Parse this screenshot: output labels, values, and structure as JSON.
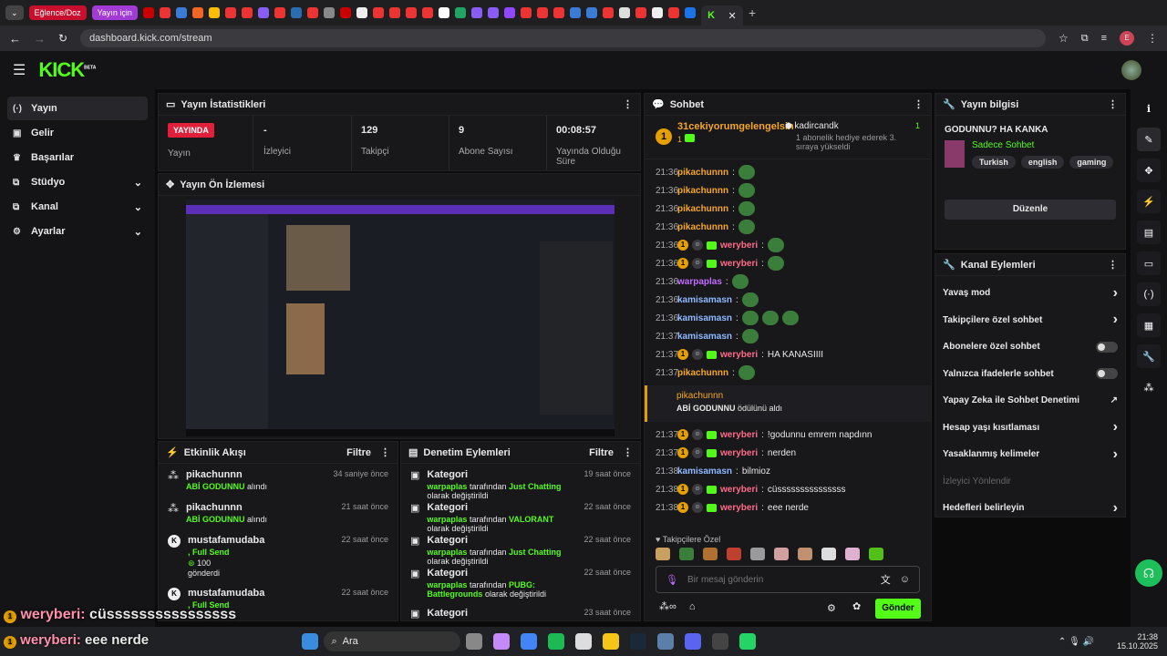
{
  "tabs": {
    "pill1": "Eğlence/Doz",
    "pill2": "Yayın için"
  },
  "address": {
    "url": "dashboard.kick.com/stream"
  },
  "brand": {
    "logo": "KICK",
    "beta": "BETA",
    "accent": "#53fc18"
  },
  "sidebar": {
    "items": [
      {
        "label": "Yayın",
        "icon": "(·)"
      },
      {
        "label": "Gelir",
        "icon": "▣"
      },
      {
        "label": "Başarılar",
        "icon": "♛"
      },
      {
        "label": "Stüdyo",
        "icon": "⧉"
      },
      {
        "label": "Kanal",
        "icon": "⧉"
      },
      {
        "label": "Ayarlar",
        "icon": "⚙"
      }
    ]
  },
  "stats": {
    "title": "Yayın İstatistikleri",
    "live_badge": "YAYINDA",
    "live_label": "Yayın",
    "viewers_value": "-",
    "viewers_label": "İzleyici",
    "followers_value": "129",
    "followers_label": "Takipçi",
    "subs_value": "9",
    "subs_label": "Abone Sayısı",
    "uptime_value": "00:08:57",
    "uptime_label": "Yayında Olduğu Süre"
  },
  "preview": {
    "title": "Yayın Ön İzlemesi"
  },
  "activity": {
    "title": "Etkinlik Akışı",
    "filter": "Filtre",
    "items": [
      {
        "user": "pikachunnn",
        "time": "34 saniye önce",
        "line1": "ABİ GODUNNU",
        "line1b": "alındı"
      },
      {
        "user": "pikachunnn",
        "time": "21 saat önce",
        "line1": "ABİ GODUNNU",
        "line1b": "alındı"
      },
      {
        "user": "mustafamudaba",
        "time": "22 saat önce",
        "line1": ", Full Send",
        "amount": "100",
        "line2": "gönderdi"
      },
      {
        "user": "mustafamudaba",
        "time": "22 saat önce",
        "line1": ", Full Send"
      }
    ]
  },
  "moderation": {
    "title": "Denetim Eylemleri",
    "filter": "Filtre",
    "items": [
      {
        "title": "Kategori",
        "time": "19 saat önce",
        "user": "warpaplas",
        "mid": "tarafından",
        "cat": "Just Chatting",
        "end": "olarak değiştirildi"
      },
      {
        "title": "Kategori",
        "time": "22 saat önce",
        "user": "warpaplas",
        "mid": "tarafından",
        "cat": "VALORANT",
        "end": "olarak değiştirildi"
      },
      {
        "title": "Kategori",
        "time": "22 saat önce",
        "user": "warpaplas",
        "mid": "tarafından",
        "cat": "Just Chatting",
        "end": "olarak değiştirildi"
      },
      {
        "title": "Kategori",
        "time": "22 saat önce",
        "user": "warpaplas",
        "mid": "tarafından",
        "cat": "PUBG: Battlegrounds",
        "end": "olarak değiştirildi"
      },
      {
        "title": "Kategori",
        "time": "23 saat önce"
      }
    ]
  },
  "chat": {
    "title": "Sohbet",
    "pinned_user": "31cekiyorumgelengelsin",
    "pinned_count": "1",
    "gifter": "kadircandk",
    "gifter_count": "1",
    "gifter_text": "1 abonelik hediye ederek 3. sıraya yükseldi",
    "messages": [
      {
        "t": "21:36",
        "u": "pikachunnn",
        "c": "#f5a623",
        "e": 1
      },
      {
        "t": "21:36",
        "u": "pikachunnn",
        "c": "#f5a623",
        "e": 1
      },
      {
        "t": "21:36",
        "u": "pikachunnn",
        "c": "#f5a623",
        "e": 1
      },
      {
        "t": "21:36",
        "u": "pikachunnn",
        "c": "#f5a623",
        "e": 1
      },
      {
        "t": "21:36",
        "u": "weryberi",
        "c": "#ff6b8a",
        "b": 1,
        "e": 1
      },
      {
        "t": "21:36",
        "u": "weryberi",
        "c": "#ff6b8a",
        "b": 1,
        "e": 1
      },
      {
        "t": "21:36",
        "u": "warpaplas",
        "c": "#c26bff",
        "e": 1
      },
      {
        "t": "21:36",
        "u": "kamisamasn",
        "c": "#8fb8ff",
        "e": 1
      },
      {
        "t": "21:36",
        "u": "kamisamasn",
        "c": "#8fb8ff",
        "e": 3
      },
      {
        "t": "21:37",
        "u": "kamisamasn",
        "c": "#8fb8ff",
        "e": 1
      },
      {
        "t": "21:37",
        "u": "weryberi",
        "c": "#ff6b8a",
        "b": 1,
        "m": "HA KANASIIII"
      },
      {
        "t": "21:37",
        "u": "pikachunnn",
        "c": "#f5a623",
        "e": 1
      }
    ],
    "reward_user": "pikachunnn",
    "reward_title": "ABİ GODUNNU",
    "reward_text": "ödülünü aldı",
    "messages2": [
      {
        "t": "21:37",
        "u": "weryberi",
        "c": "#ff6b8a",
        "b": 1,
        "m": "!godunnu emrem napdınn"
      },
      {
        "t": "21:37",
        "u": "weryberi",
        "c": "#ff6b8a",
        "b": 1,
        "m": "nerden"
      },
      {
        "t": "21:38",
        "u": "kamisamasn",
        "c": "#8fb8ff",
        "m": "bilmioz"
      },
      {
        "t": "21:38",
        "u": "weryberi",
        "c": "#ff6b8a",
        "b": 1,
        "m": "cüsssssssssssssss"
      },
      {
        "t": "21:38",
        "u": "weryberi",
        "c": "#ff6b8a",
        "b": 1,
        "m": "eee nerde"
      }
    ],
    "emote_section": "Takipçilere Özel",
    "placeholder": "Bir mesaj gönderin",
    "send": "Gönder"
  },
  "info": {
    "title": "Yayın bilgisi",
    "stream_title": "GODUNNU? HA KANKA",
    "category": "Sadece Sohbet",
    "tags": [
      "Turkish",
      "english",
      "gaming"
    ],
    "edit": "Düzenle"
  },
  "actions": {
    "title": "Kanal Eylemleri",
    "items": [
      {
        "label": "Yavaş mod",
        "kind": "arrow"
      },
      {
        "label": "Takipçilere özel sohbet",
        "kind": "arrow"
      },
      {
        "label": "Abonelere özel sohbet",
        "kind": "toggle"
      },
      {
        "label": "Yalnızca ifadelerle sohbet",
        "kind": "toggle"
      },
      {
        "label": "Yapay Zeka ile Sohbet Denetimi",
        "kind": "ext"
      },
      {
        "label": "Hesap yaşı kısıtlaması",
        "kind": "arrow"
      },
      {
        "label": "Yasaklanmış kelimeler",
        "kind": "arrow"
      },
      {
        "label": "İzleyici Yönlendir",
        "kind": "disabled"
      },
      {
        "label": "Hedefleri belirleyin",
        "kind": "arrow"
      }
    ]
  },
  "overlay": {
    "line1_user": "weryberi:",
    "line1_msg": "cüssssssssssssssss",
    "line2_user": "weryberi:",
    "line2_msg": "eee nerde"
  },
  "taskbar": {
    "search": "Ara",
    "time": "21:38",
    "date": "15.10.2025"
  }
}
